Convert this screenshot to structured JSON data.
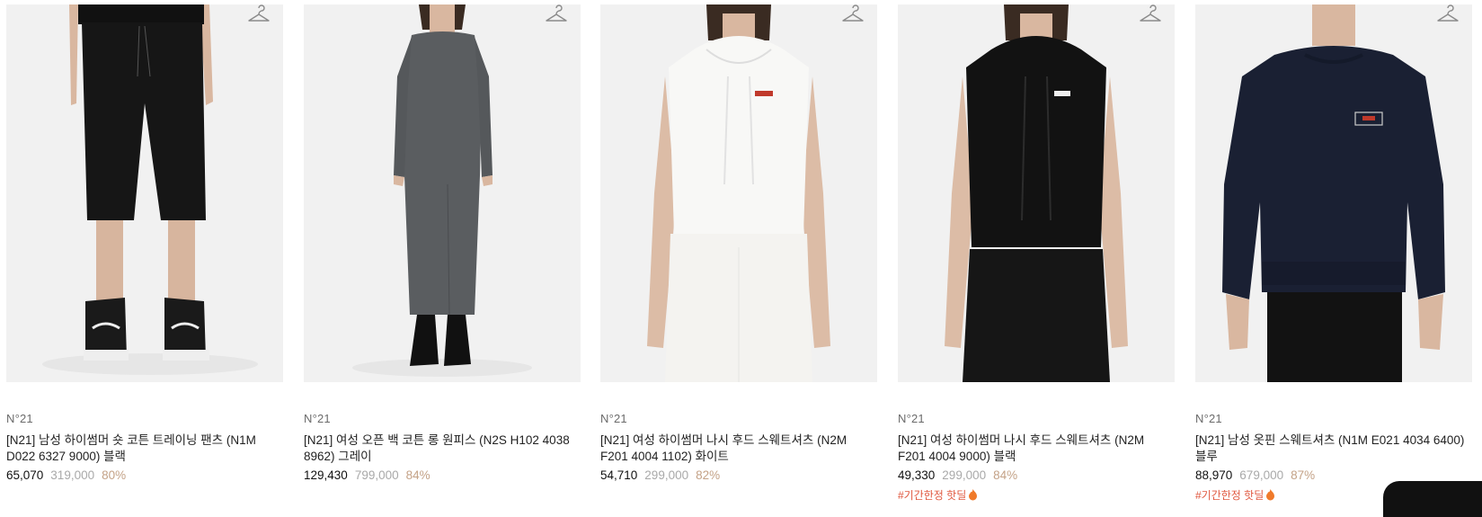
{
  "products": [
    {
      "brand": "N°21",
      "name": "[N21] 남성 하이썸머 숏 코튼 트레이닝 팬츠 (N1M D022 6327 9000) 블랙",
      "price": "65,070",
      "original_price": "319,000",
      "discount": "80%",
      "tag": "",
      "icon": "hanger-icon"
    },
    {
      "brand": "N°21",
      "name": "[N21] 여성 오픈 백 코튼 롱 원피스 (N2S H102 4038 8962) 그레이",
      "price": "129,430",
      "original_price": "799,000",
      "discount": "84%",
      "tag": "",
      "icon": "hanger-icon"
    },
    {
      "brand": "N°21",
      "name": "[N21] 여성 하이썸머 나시 후드 스웨트셔츠 (N2M F201 4004 1102) 화이트",
      "price": "54,710",
      "original_price": "299,000",
      "discount": "82%",
      "tag": "",
      "icon": "hanger-icon"
    },
    {
      "brand": "N°21",
      "name": "[N21] 여성 하이썸머 나시 후드 스웨트셔츠 (N2M F201 4004 9000) 블랙",
      "price": "49,330",
      "original_price": "299,000",
      "discount": "84%",
      "tag": "#기간한정 핫딜",
      "icon": "hanger-icon"
    },
    {
      "brand": "N°21",
      "name": "[N21] 남성 옷핀 스웨트셔츠 (N1M E021 4034 6400) 블루",
      "price": "88,970",
      "original_price": "679,000",
      "discount": "87%",
      "tag": "#기간한정 핫딜",
      "icon": "hanger-icon"
    }
  ],
  "colors": {
    "discount": "#c4a287",
    "original_price": "#a9a9a9",
    "tag": "#e0583f",
    "photo_background": "#f1f1f1"
  }
}
